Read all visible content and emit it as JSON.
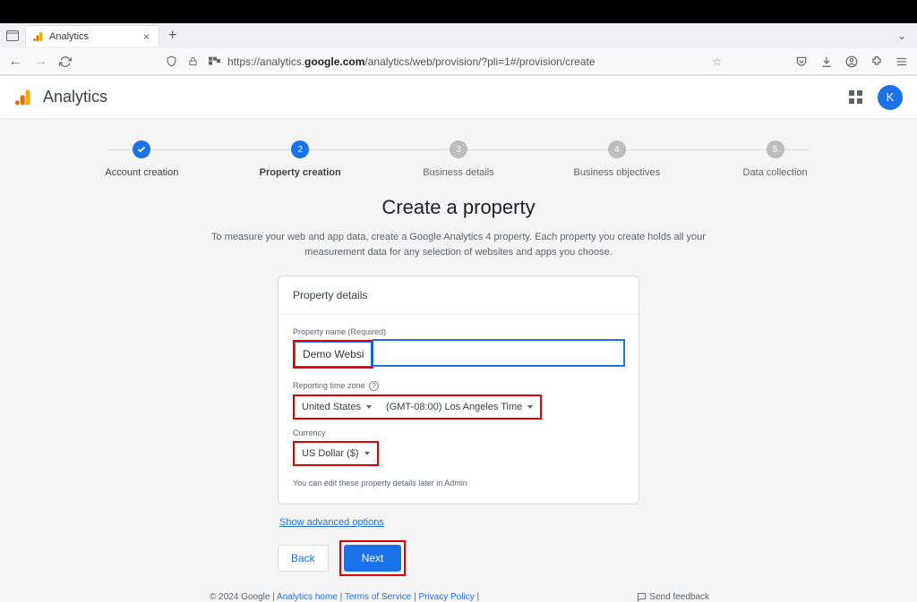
{
  "browser": {
    "tab_title": "Analytics",
    "url_prefix": "https://analytics.",
    "url_bold": "google.com",
    "url_suffix": "/analytics/web/provision/?pli=1#/provision/create"
  },
  "header": {
    "app_title": "Analytics",
    "avatar_letter": "K"
  },
  "stepper": {
    "steps": [
      {
        "label": "Account creation",
        "icon": "✓"
      },
      {
        "label": "Property creation",
        "num": "2"
      },
      {
        "label": "Business details",
        "num": "3"
      },
      {
        "label": "Business objectives",
        "num": "4"
      },
      {
        "label": "Data collection",
        "num": "5"
      }
    ]
  },
  "page": {
    "title": "Create a property",
    "description": "To measure your web and app data, create a Google Analytics 4 property. Each property you create holds all your measurement data for any selection of websites and apps you choose."
  },
  "card": {
    "header": "Property details",
    "property_name_label": "Property name (Required)",
    "property_name_value": "Demo Website",
    "timezone_label": "Reporting time zone",
    "country": "United States",
    "tz": "(GMT-08:00) Los Angeles Time",
    "currency_label": "Currency",
    "currency": "US Dollar ($)",
    "hint": "You can edit these property details later in Admin"
  },
  "advanced": "Show advanced options",
  "buttons": {
    "back": "Back",
    "next": "Next"
  },
  "footer": {
    "copyright": "© 2024 Google",
    "links": [
      "Analytics home",
      "Terms of Service",
      "Privacy Policy"
    ],
    "feedback": "Send feedback"
  }
}
